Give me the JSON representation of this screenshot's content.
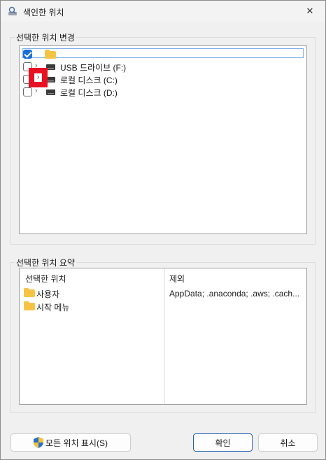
{
  "window": {
    "title": "색인한 위치",
    "close_label": "✕"
  },
  "change_group": {
    "label": "선택한 위치 변경",
    "tree": [
      {
        "label": "",
        "checked": true,
        "kind": "folder"
      },
      {
        "label": "USB 드라이브 (F:)",
        "checked": false,
        "kind": "drive"
      },
      {
        "label": "로컬 디스크 (C:)",
        "checked": false,
        "kind": "drive"
      },
      {
        "label": "로컬 디스크 (D:)",
        "checked": false,
        "kind": "drive"
      }
    ]
  },
  "summary_group": {
    "label": "선택한 위치 요약",
    "col_selected": "선택한 위치",
    "col_exclude": "제외",
    "items": [
      "사용자",
      "시작 메뉴"
    ],
    "exclude_text": "AppData; .anaconda; .aws; .cach..."
  },
  "buttons": {
    "show_all": "모든 위치 표시(S)",
    "ok": "확인",
    "cancel": "취소"
  },
  "colors": {
    "accent": "#1a6fd6",
    "highlight": "#e81123",
    "folder": "#f6c445"
  }
}
